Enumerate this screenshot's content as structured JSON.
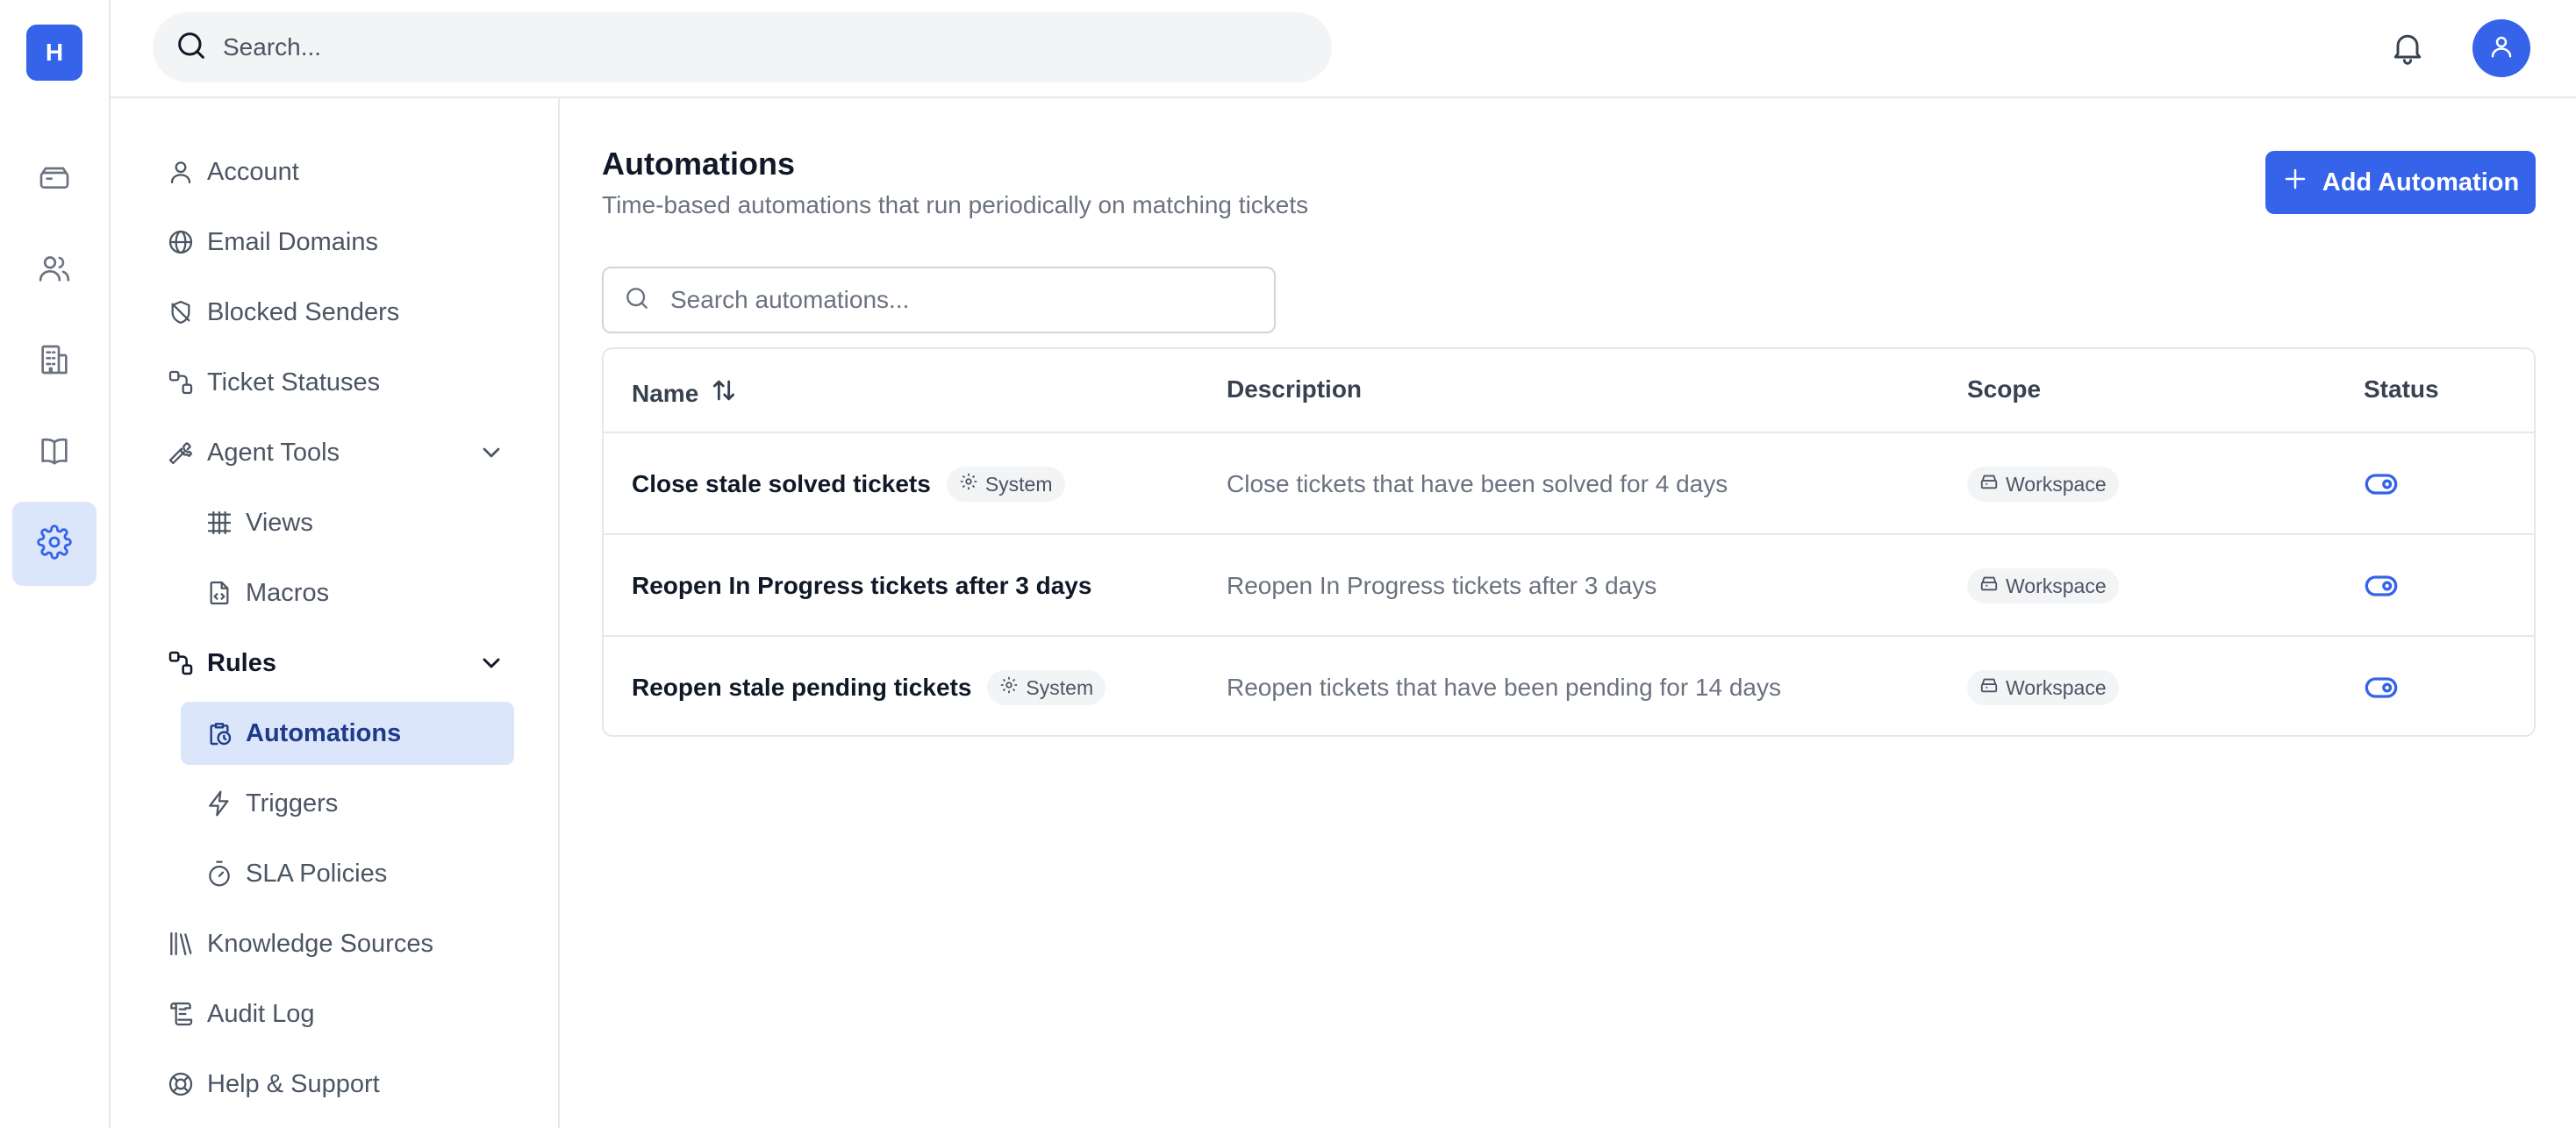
{
  "app": {
    "logo_letter": "H"
  },
  "topbar": {
    "search_placeholder": "Search..."
  },
  "nav": {
    "items": [
      {
        "label": "Account"
      },
      {
        "label": "Email Domains"
      },
      {
        "label": "Blocked Senders"
      },
      {
        "label": "Ticket Statuses"
      },
      {
        "label": "Agent Tools"
      },
      {
        "label": "Views"
      },
      {
        "label": "Macros"
      },
      {
        "label": "Rules"
      },
      {
        "label": "Automations"
      },
      {
        "label": "Triggers"
      },
      {
        "label": "SLA Policies"
      },
      {
        "label": "Knowledge Sources"
      },
      {
        "label": "Audit Log"
      },
      {
        "label": "Help & Support"
      }
    ]
  },
  "page": {
    "title": "Automations",
    "subtitle": "Time-based automations that run periodically on matching tickets",
    "add_button": "Add Automation",
    "search_placeholder": "Search automations..."
  },
  "table": {
    "columns": [
      "Name",
      "Description",
      "Scope",
      "Status"
    ],
    "rows": [
      {
        "name": "Close stale solved tickets",
        "badge": "System",
        "description": "Close tickets that have been solved for 4 days",
        "scope": "Workspace",
        "status": "enabled"
      },
      {
        "name": "Reopen In Progress tickets after 3 days",
        "badge": "",
        "description": "Reopen In Progress tickets after 3 days",
        "scope": "Workspace",
        "status": "enabled"
      },
      {
        "name": "Reopen stale pending tickets",
        "badge": "System",
        "description": "Reopen tickets that have been pending for 14 days",
        "scope": "Workspace",
        "status": "enabled"
      }
    ]
  },
  "colors": {
    "accent": "#3563e9",
    "active_bg": "#dbe6fb"
  }
}
